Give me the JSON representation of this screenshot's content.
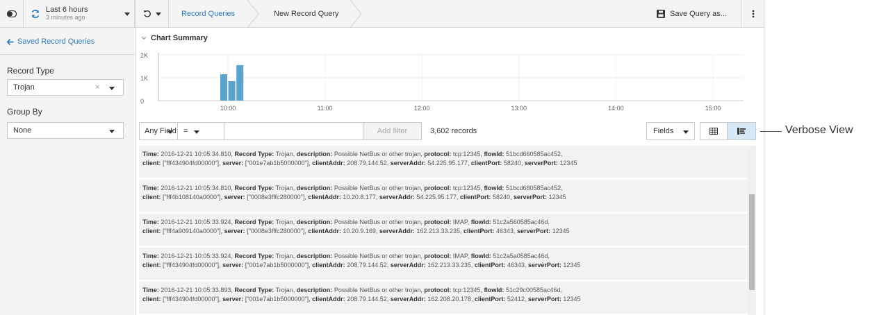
{
  "topbar": {
    "time_range": "Last 6 hours",
    "time_updated": "3 minutes ago",
    "breadcrumbs": [
      "Record Queries",
      "New Record Query"
    ],
    "save_label": "Save Query as...",
    "icons": [
      "sidebar-toggle-icon",
      "refresh-icon",
      "history-icon",
      "save-icon",
      "kebab-menu-icon"
    ]
  },
  "sidebar": {
    "back_label": "Saved Record Queries",
    "record_type_label": "Record Type",
    "record_type_value": "Trojan",
    "group_by_label": "Group By",
    "group_by_value": "None"
  },
  "chart": {
    "heading": "Chart Summary",
    "chart_data": {
      "type": "bar",
      "title": "Chart Summary",
      "yticks": [
        "2K",
        "1K",
        "0"
      ],
      "ylim": [
        0,
        2000
      ],
      "xticks": [
        "10:00",
        "11:00",
        "12:00",
        "13:00",
        "14:00",
        "15:00"
      ],
      "bars": [
        {
          "time": "10:00",
          "value": 1150
        },
        {
          "time": "10:05",
          "value": 850
        },
        {
          "time": "10:10",
          "value": 1550
        }
      ],
      "color": "#5aa3cc"
    }
  },
  "filter": {
    "field_value": "Any Field",
    "operator_value": "=",
    "value_placeholder": "",
    "add_filter_label": "Add filter",
    "record_count": "3,602 records",
    "fields_label": "Fields",
    "views": [
      "table-view-icon",
      "verbose-view-icon"
    ]
  },
  "records": [
    {
      "line1": [
        [
          "Time:",
          " 2016-12-21 10:05:34.810, "
        ],
        [
          "Record Type:",
          " Trojan,  "
        ],
        [
          "description:",
          " Possible NetBus or other trojan, "
        ],
        [
          "protocol:",
          " tcp:12345, "
        ],
        [
          "flowId:",
          " 51bcd660585ac452,"
        ]
      ],
      "line2": [
        [
          "client:",
          " [\"fff434904fd00000\"], "
        ],
        [
          "server:",
          " [\"001e7ab1b5000000\"], "
        ],
        [
          "clientAddr:",
          " 208.79.144.52, "
        ],
        [
          "serverAddr:",
          " 54.225.95.177, "
        ],
        [
          "clientPort:",
          " 58240, "
        ],
        [
          "serverPort:",
          " 12345"
        ]
      ]
    },
    {
      "line1": [
        [
          "Time:",
          " 2016-12-21 10:05:34.810, "
        ],
        [
          "Record Type:",
          " Trojan,  "
        ],
        [
          "description:",
          " Possible NetBus or other trojan, "
        ],
        [
          "protocol:",
          " tcp:12345, "
        ],
        [
          "flowId:",
          " 51bcd680585ac452,"
        ]
      ],
      "line2": [
        [
          "client:",
          " [\"fff4b108140a0000\"], "
        ],
        [
          "server:",
          " [\"0008e3fffc280000\"], "
        ],
        [
          "clientAddr:",
          " 10.20.8.177, "
        ],
        [
          "serverAddr:",
          " 54.225.95.177, "
        ],
        [
          "clientPort:",
          " 58240, "
        ],
        [
          "serverPort:",
          " 12345"
        ]
      ]
    },
    {
      "line1": [
        [
          "Time:",
          " 2016-12-21 10:05:33.924, "
        ],
        [
          "Record Type:",
          " Trojan,  "
        ],
        [
          "description:",
          " Possible NetBus or other trojan, "
        ],
        [
          "protocol:",
          " IMAP, "
        ],
        [
          "flowId:",
          " 51c2a560585ac46d,"
        ]
      ],
      "line2": [
        [
          "client:",
          " [\"fff4a909140a0000\"], "
        ],
        [
          "server:",
          " [\"0008e3fffc280000\"], "
        ],
        [
          "clientAddr:",
          " 10.20.9.169, "
        ],
        [
          "serverAddr:",
          " 162.213.33.235, "
        ],
        [
          "clientPort:",
          " 46343, "
        ],
        [
          "serverPort:",
          " 12345"
        ]
      ]
    },
    {
      "line1": [
        [
          "Time:",
          " 2016-12-21 10:05:33.924, "
        ],
        [
          "Record Type:",
          " Trojan,  "
        ],
        [
          "description:",
          " Possible NetBus or other trojan, "
        ],
        [
          "protocol:",
          " IMAP, "
        ],
        [
          "flowId:",
          " 51c2a5a0585ac46d,"
        ]
      ],
      "line2": [
        [
          "client:",
          " [\"fff434904fd00000\"], "
        ],
        [
          "server:",
          " [\"001e7ab1b5000000\"], "
        ],
        [
          "clientAddr:",
          " 208.79.144.52, "
        ],
        [
          "serverAddr:",
          " 162.213.33.235, "
        ],
        [
          "clientPort:",
          " 46343, "
        ],
        [
          "serverPort:",
          " 12345"
        ]
      ]
    },
    {
      "line1": [
        [
          "Time:",
          " 2016-12-21 10:05:33.893, "
        ],
        [
          "Record Type:",
          " Trojan,  "
        ],
        [
          "description:",
          " Possible NetBus or other trojan, "
        ],
        [
          "protocol:",
          " tcp:12345, "
        ],
        [
          "flowId:",
          " 51c29c00585ac46d,"
        ]
      ],
      "line2": [
        [
          "client:",
          " [\"fff434904fd00000\"], "
        ],
        [
          "server:",
          " [\"001e7ab1b5000000\"], "
        ],
        [
          "clientAddr:",
          " 208.79.144.52, "
        ],
        [
          "serverAddr:",
          " 162.208.20.178, "
        ],
        [
          "clientPort:",
          " 52412, "
        ],
        [
          "serverPort:",
          " 12345"
        ]
      ]
    }
  ],
  "callout": {
    "label": "Verbose View"
  },
  "colors": {
    "accent": "#2e7cbd",
    "bar": "#5aa3cc",
    "active_view_bg": "#d7e9f7"
  }
}
